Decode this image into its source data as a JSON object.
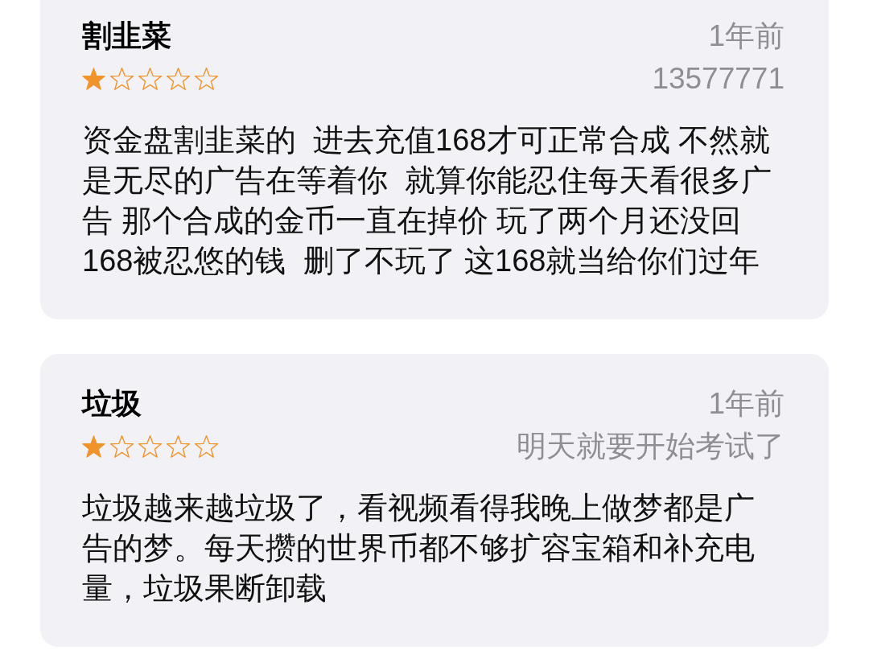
{
  "reviews": [
    {
      "title": "割韭菜",
      "date": "1年前",
      "stars": 1,
      "reviewer": "13577771",
      "body": "资金盘割韭菜的  进去充值168才可正常合成 不然就是无尽的广告在等着你  就算你能忍住每天看很多广告 那个合成的金币一直在掉价 玩了两个月还没回168被忍悠的钱  删了不玩了 这168就当给你们过年"
    },
    {
      "title": "垃圾",
      "date": "1年前",
      "stars": 1,
      "reviewer": "明天就要开始考试了",
      "body": "垃圾越来越垃圾了，看视频看得我晚上做梦都是广告的梦。每天攒的世界币都不够扩容宝箱和补充电量，垃圾果断卸载"
    }
  ]
}
